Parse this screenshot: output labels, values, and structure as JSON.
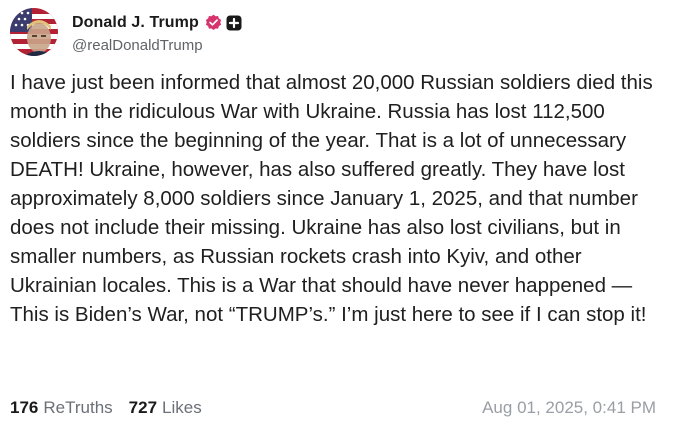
{
  "author": {
    "display_name": "Donald J. Trump",
    "handle": "@realDonaldTrump"
  },
  "icons": {
    "verified": "verified-badge-icon",
    "plus": "plus-badge-icon",
    "avatar": "american-flag-portrait"
  },
  "colors": {
    "verified": "#d6336c",
    "plus_badge": "#1a1a1a",
    "text": "#1f1f1f",
    "muted": "#6b6f76"
  },
  "post": {
    "text": "I have just been informed that almost 20,000 Russian soldiers died this month in the ridiculous War with Ukraine. Russia has lost 112,500 soldiers since the beginning of the year. That is a lot of unnecessary DEATH! Ukraine, however, has also suffered greatly. They have lost approximately 8,000 soldiers since January 1, 2025, and that number does not include their missing. Ukraine has also lost civilians, but in smaller numbers, as Russian rockets crash into Kyiv, and other Ukrainian locales. This is a War that should have never happened — This is Biden’s War, not “TRUMP’s.” I’m just here to see if I can stop it!"
  },
  "stats": {
    "retruths_count": "176",
    "retruths_label": "ReTruths",
    "likes_count": "727",
    "likes_label": "Likes"
  },
  "timestamp": "Aug 01, 2025, 0:41 PM"
}
